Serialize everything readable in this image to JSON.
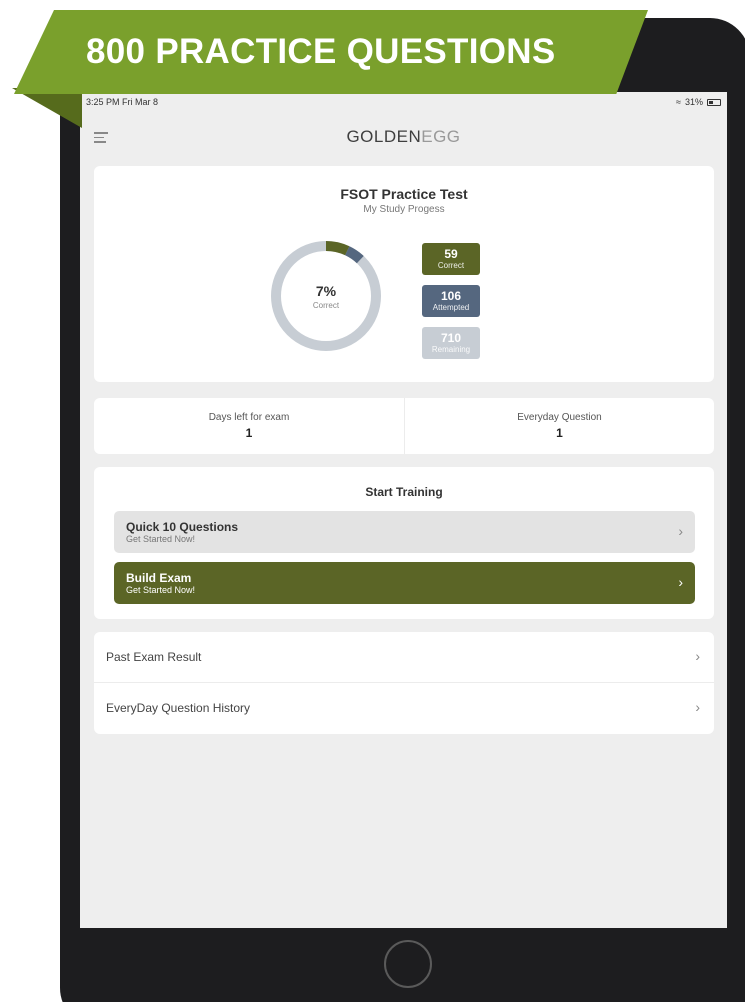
{
  "banner": {
    "text": "800 PRACTICE QUESTIONS"
  },
  "status_bar": {
    "time": "3:25 PM  Fri Mar 8",
    "battery": "31%"
  },
  "header": {
    "logo_main": "GOLDEN",
    "logo_accent": "EGG"
  },
  "progress": {
    "title": "FSOT Practice Test",
    "subtitle": "My Study Progess",
    "percent": "7%",
    "percent_label": "Correct",
    "percent_value": 0.07,
    "stats": {
      "correct": {
        "value": "59",
        "label": "Correct"
      },
      "attempted": {
        "value": "106",
        "label": "Attempted"
      },
      "remaining": {
        "value": "710",
        "label": "Remaining"
      }
    }
  },
  "days": {
    "left_label": "Days left for exam",
    "left_value": "1",
    "right_label": "Everyday Question",
    "right_value": "1"
  },
  "training": {
    "title": "Start Training",
    "quick": {
      "title": "Quick 10 Questions",
      "subtitle": "Get Started Now!"
    },
    "build": {
      "title": "Build Exam",
      "subtitle": "Get Started Now!"
    }
  },
  "links": {
    "past": "Past Exam Result",
    "history": "EveryDay Question History"
  },
  "colors": {
    "accent_olive": "#5b6526",
    "attempted_blue": "#55677f",
    "remaining_gray": "#c7cdd4",
    "banner_green": "#7aa02c"
  }
}
